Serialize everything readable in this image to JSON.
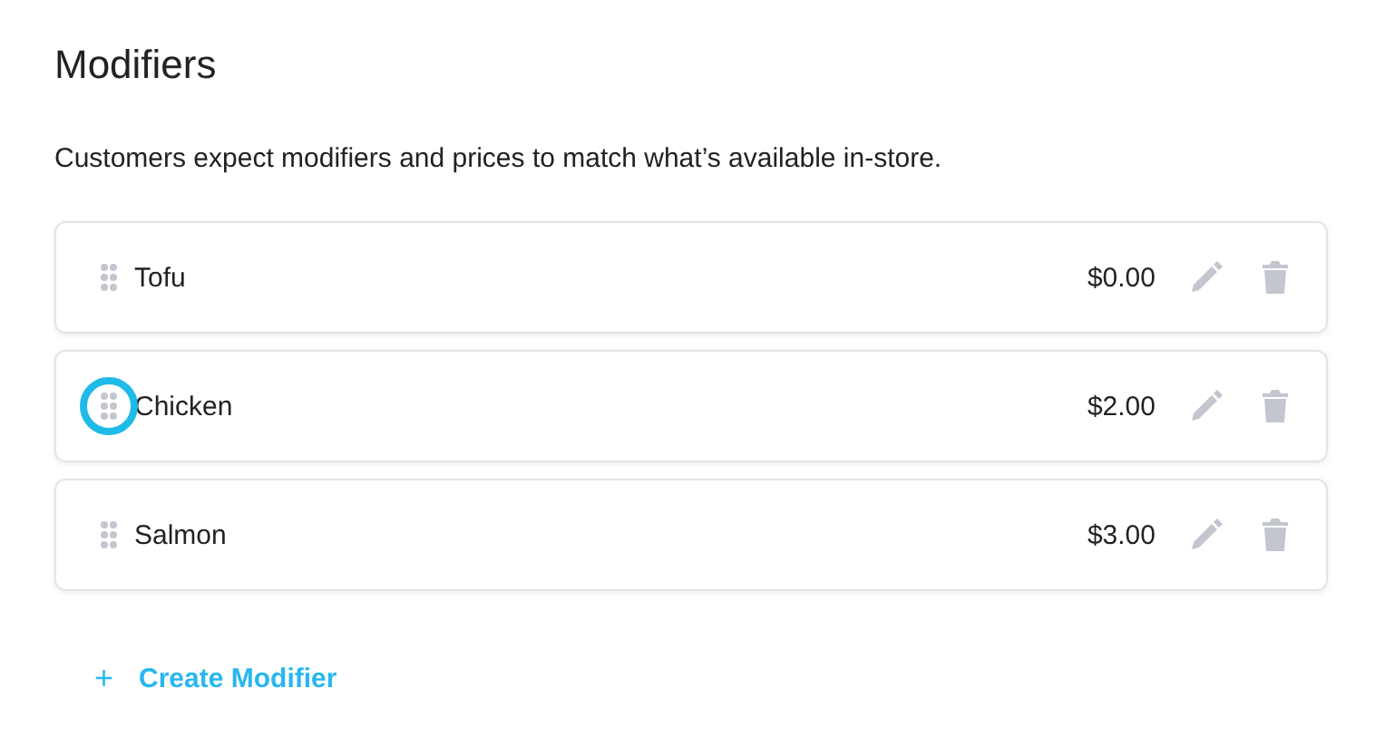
{
  "title": "Modifiers",
  "description": "Customers expect modifiers and prices to match what’s available in-store.",
  "modifiers": [
    {
      "name": "Tofu",
      "price": "$0.00",
      "highlighted": false
    },
    {
      "name": "Chicken",
      "price": "$2.00",
      "highlighted": true
    },
    {
      "name": "Salmon",
      "price": "$3.00",
      "highlighted": false
    }
  ],
  "create_button": {
    "icon": "+",
    "label": "Create Modifier"
  }
}
